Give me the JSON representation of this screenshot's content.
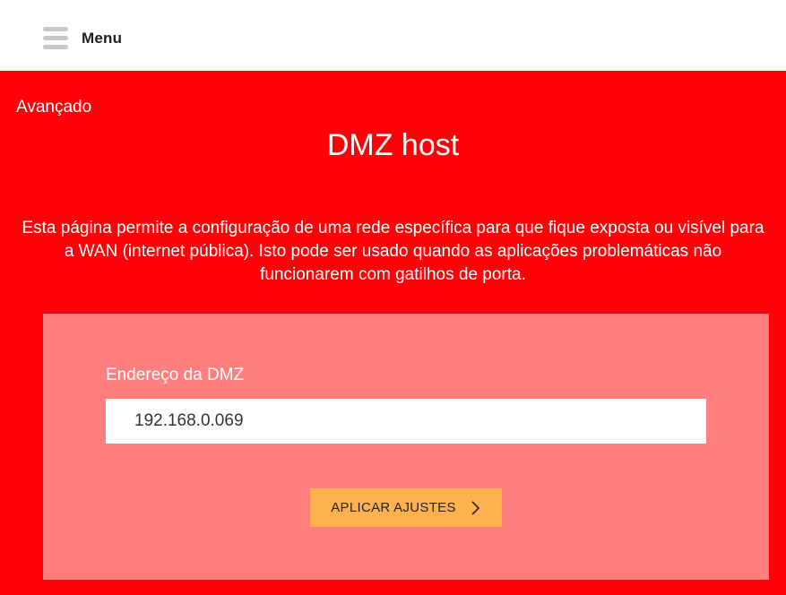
{
  "header": {
    "menu_label": "Menu"
  },
  "breadcrumb": "Avançado",
  "page_title": "DMZ host",
  "description": "Esta página permite a configuração de uma rede específica para que fique exposta ou visível para a WAN (internet pública). Isto pode ser usado quando as aplicações problemáticas não funcionarem com gatilhos de porta.",
  "form": {
    "dmz_label": "Endereço da DMZ",
    "dmz_value": "192.168.0.069",
    "apply_label": "APLICAR AJUSTES"
  },
  "icons": {
    "menu": "hamburger-icon",
    "apply": "chevron-right-icon"
  },
  "colors": {
    "background": "#ff0008",
    "panel": "#ff7f7f",
    "button": "#fdb24f"
  }
}
